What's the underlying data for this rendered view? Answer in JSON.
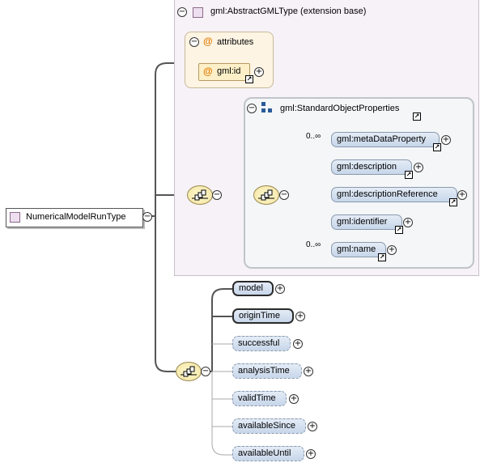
{
  "extension": {
    "title": "gml:AbstractGMLType (extension base)"
  },
  "attributes": {
    "title": "attributes",
    "at_symbol": "@",
    "items": [
      {
        "label": "gml:id"
      }
    ]
  },
  "group": {
    "title": "gml:StandardObjectProperties",
    "elements": [
      {
        "label": "gml:metaDataProperty",
        "occurrence": "0..∞"
      },
      {
        "label": "gml:description",
        "occurrence": ""
      },
      {
        "label": "gml:descriptionReference",
        "occurrence": ""
      },
      {
        "label": "gml:identifier",
        "occurrence": ""
      },
      {
        "label": "gml:name",
        "occurrence": "0..∞"
      }
    ]
  },
  "root": {
    "label": "NumericalModelRunType"
  },
  "sequence_elements": [
    {
      "label": "model",
      "style": "bold"
    },
    {
      "label": "originTime",
      "style": "bold"
    },
    {
      "label": "successful",
      "style": "dashed"
    },
    {
      "label": "analysisTime",
      "style": "dashed"
    },
    {
      "label": "validTime",
      "style": "dashed"
    },
    {
      "label": "availableSince",
      "style": "dashed"
    },
    {
      "label": "availableUntil",
      "style": "dashed"
    }
  ],
  "symbols": {
    "collapse": "−",
    "expand": "+",
    "link": "↗"
  },
  "colors": {
    "extension_bg": "#f7f2f7",
    "attributes_bg": "#fdf4e3",
    "element_fill": "#c7d6ea",
    "sequence_fill": "#f3e3a0"
  }
}
